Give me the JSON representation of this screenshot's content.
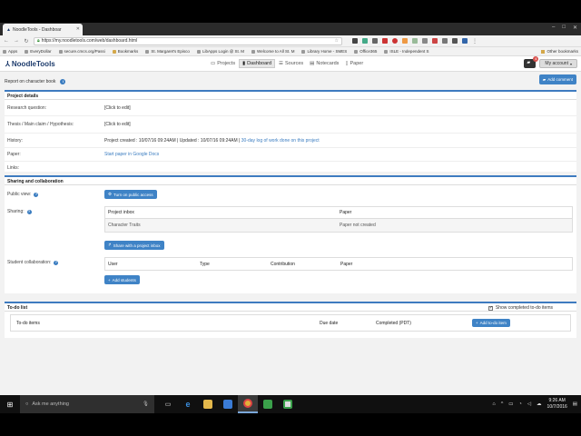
{
  "browser": {
    "tab_title": "NoodleTools - Dashboar",
    "url": "https://my.noodletools.com/web/dashboard.html",
    "bookmarks": [
      "Apps",
      "EveryDollar",
      "secure.cmcs.org/Passi",
      "Bookmarks",
      "St. Margaret's Episco",
      "LibApps Login @ St. M",
      "Welcome to All St. M",
      "Library Home - SMES",
      "Office365",
      "ISLE - Independent S"
    ],
    "other_bookmarks": "Other bookmarks"
  },
  "app": {
    "logo": "NoodleTools",
    "nav": [
      "Projects",
      "Dashboard",
      "Sources",
      "Notecards",
      "Paper"
    ],
    "account_label": "My account",
    "notif_count": "4"
  },
  "project": {
    "title": "Report on character book",
    "add_comment": "Add comment"
  },
  "details": {
    "heading": "Project details",
    "research_label": "Research question:",
    "research_value": "[Click to edit]",
    "thesis_label": "Thesis / Main claim / Hypothesis:",
    "thesis_value": "[Click to edit]",
    "history_label": "History:",
    "history_value": "Project created : 10/07/16 09:24AM | Updated : 10/07/16 09:24AM |",
    "history_link": "30-day log of work done on this project",
    "paper_label": "Paper:",
    "paper_link": "Start paper in Google Docs",
    "links_label": "Links:"
  },
  "sharing": {
    "heading": "Sharing and collaboration",
    "public_label": "Public view:",
    "public_button": "Turn on public access",
    "sharing_label": "Sharing:",
    "inbox_headers": [
      "Project inbox",
      "Paper"
    ],
    "inbox_row": [
      "Character Traits",
      "Paper not created"
    ],
    "share_button": "Share with a project inbox",
    "collab_label": "Student collaboration:",
    "collab_headers": [
      "User",
      "Type",
      "Contribution",
      "Paper"
    ],
    "add_students": "Add students"
  },
  "todo": {
    "heading": "To-do list",
    "show_completed": "Show completed to-do items",
    "headers": [
      "To-do items",
      "Due date",
      "Completed (PDT)"
    ],
    "add_button": "Add to-do item"
  },
  "taskbar": {
    "search_placeholder": "Ask me anything",
    "time": "9:26 AM",
    "date": "10/7/2016"
  }
}
